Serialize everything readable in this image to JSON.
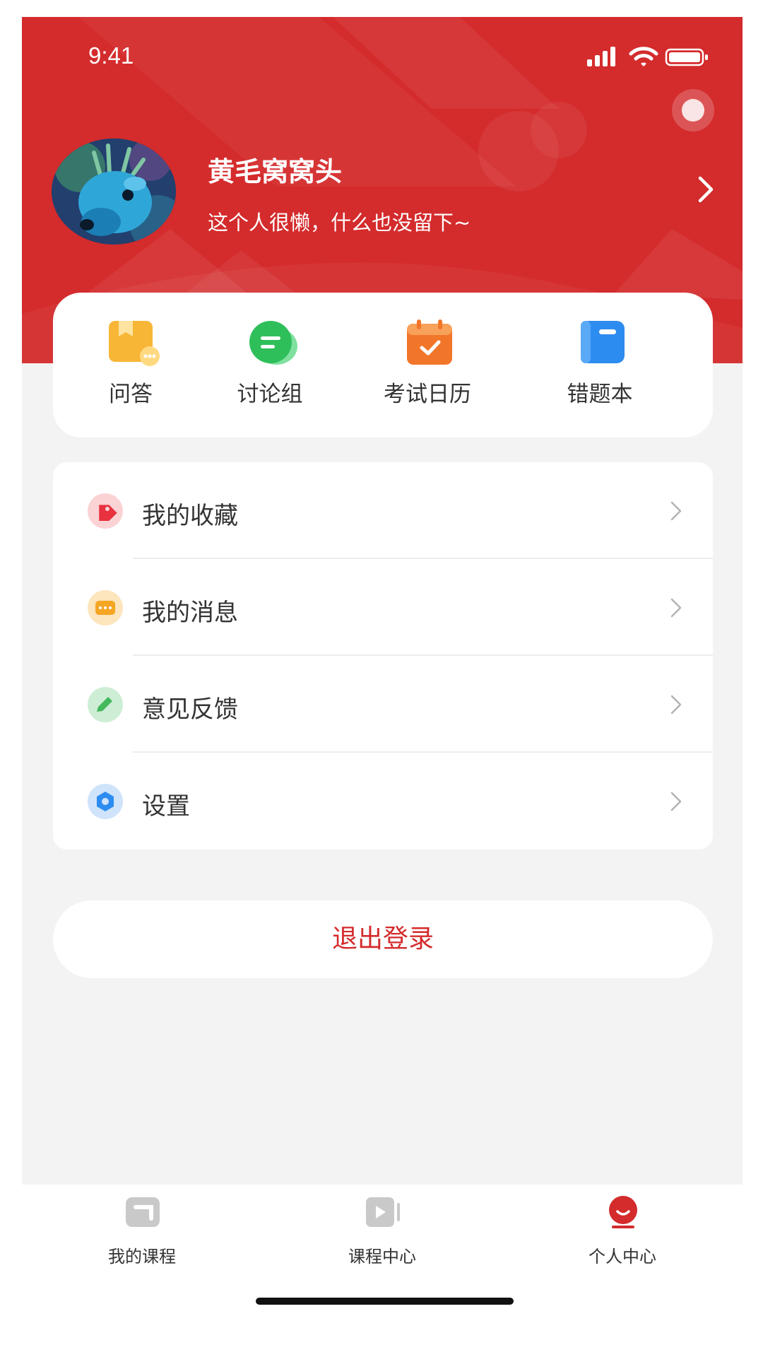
{
  "status_bar": {
    "time": "9:41"
  },
  "profile": {
    "name": "黄毛窝窝头",
    "bio": "这个人很懒，什么也没留下~"
  },
  "quick_actions": [
    {
      "label": "问答",
      "icon": "qa-folder-icon",
      "color": "#f8b637"
    },
    {
      "label": "讨论组",
      "icon": "chat-bubble-icon",
      "color": "#2fbf5a"
    },
    {
      "label": "考试日历",
      "icon": "calendar-check-icon",
      "color": "#f2762a"
    },
    {
      "label": "错题本",
      "icon": "notebook-icon",
      "color": "#2d8cf0"
    }
  ],
  "menu": [
    {
      "label": "我的收藏",
      "icon": "tag-icon",
      "color": "#e8323f"
    },
    {
      "label": "我的消息",
      "icon": "message-icon",
      "color": "#f5a623"
    },
    {
      "label": "意见反馈",
      "icon": "pencil-icon",
      "color": "#43b85c"
    },
    {
      "label": "设置",
      "icon": "gear-icon",
      "color": "#2d8cf0"
    }
  ],
  "logout_label": "退出登录",
  "tabs": [
    {
      "label": "我的课程",
      "icon": "my-courses-icon",
      "active": false
    },
    {
      "label": "课程中心",
      "icon": "course-center-icon",
      "active": false
    },
    {
      "label": "个人中心",
      "icon": "profile-icon",
      "active": true
    }
  ],
  "colors": {
    "accent": "#d42b2c",
    "background": "#f3f3f3",
    "inactive_icon": "#c9c9c9"
  }
}
